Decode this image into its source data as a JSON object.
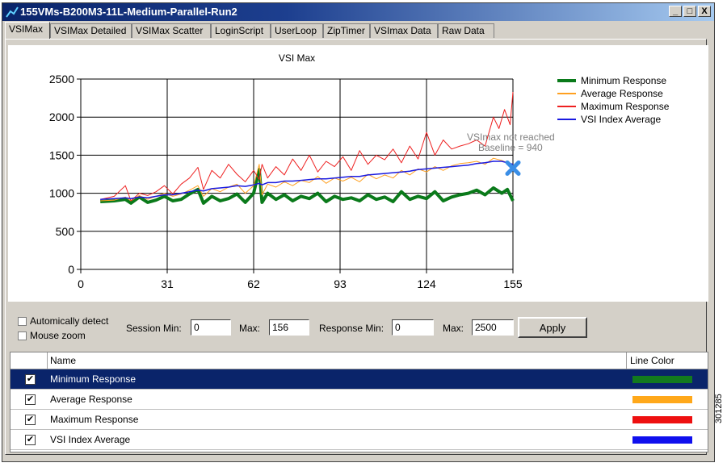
{
  "window": {
    "title": "155VMs-B200M3-11L-Medium-Parallel-Run2",
    "controls": [
      "_",
      "□",
      "X"
    ]
  },
  "tabs": [
    "VSIMax",
    "VSIMax Detailed",
    "VSIMax Scatter",
    "LoginScript",
    "UserLoop",
    "ZipTimer",
    "VSImax Data",
    "Raw Data"
  ],
  "active_tab": "VSIMax",
  "chart_data": {
    "type": "line",
    "title": "VSI Max",
    "xlim": [
      0,
      155
    ],
    "ylim": [
      0,
      2500
    ],
    "x_ticks": [
      "0",
      "31",
      "62",
      "93",
      "124",
      "155"
    ],
    "y_ticks": [
      "0",
      "500",
      "1000",
      "1500",
      "2000",
      "2500"
    ],
    "grid": true,
    "legend_position": "right",
    "annotation": [
      "VSImax not reached",
      "Baseline = 940"
    ],
    "marker": {
      "x": 155,
      "y": 1330,
      "color": "#3a8ee6"
    },
    "series": [
      {
        "name": "Minimum Response",
        "color": "#0a7a1a",
        "x": [
          7,
          12,
          16,
          18,
          21,
          24,
          27,
          30,
          33,
          36,
          39,
          42,
          44,
          47,
          50,
          53,
          56,
          59,
          62,
          64,
          65,
          67,
          70,
          73,
          76,
          79,
          82,
          85,
          88,
          91,
          94,
          97,
          100,
          103,
          106,
          109,
          112,
          115,
          118,
          121,
          124,
          127,
          130,
          133,
          136,
          139,
          142,
          145,
          148,
          151,
          153,
          155
        ],
        "y": [
          890,
          900,
          920,
          870,
          950,
          880,
          910,
          960,
          900,
          920,
          990,
          1050,
          870,
          960,
          900,
          930,
          990,
          880,
          1000,
          1310,
          880,
          1000,
          920,
          980,
          900,
          960,
          930,
          1000,
          890,
          960,
          920,
          940,
          900,
          980,
          920,
          950,
          890,
          1020,
          920,
          960,
          930,
          1020,
          900,
          950,
          980,
          1000,
          1040,
          980,
          1070,
          1000,
          1050,
          900
        ]
      },
      {
        "name": "Average Response",
        "color": "#ffa020",
        "x": [
          7,
          12,
          16,
          18,
          21,
          24,
          27,
          30,
          33,
          36,
          39,
          42,
          44,
          47,
          50,
          53,
          56,
          59,
          62,
          64,
          65,
          67,
          70,
          73,
          76,
          79,
          82,
          85,
          88,
          91,
          94,
          97,
          100,
          103,
          106,
          109,
          112,
          115,
          118,
          121,
          124,
          127,
          130,
          133,
          136,
          139,
          142,
          145,
          148,
          151,
          153,
          155
        ],
        "y": [
          900,
          910,
          950,
          900,
          970,
          920,
          960,
          1000,
          960,
          990,
          1040,
          1100,
          960,
          1060,
          1020,
          1080,
          1120,
          1000,
          1100,
          1380,
          980,
          1120,
          1080,
          1150,
          1100,
          1170,
          1140,
          1220,
          1130,
          1200,
          1160,
          1210,
          1150,
          1250,
          1190,
          1240,
          1200,
          1300,
          1240,
          1320,
          1280,
          1350,
          1300,
          1360,
          1390,
          1400,
          1420,
          1380,
          1460,
          1430,
          1400,
          1360
        ]
      },
      {
        "name": "Maximum Response",
        "color": "#ee2020",
        "x": [
          7,
          12,
          16,
          18,
          21,
          24,
          27,
          30,
          33,
          36,
          39,
          42,
          44,
          47,
          50,
          53,
          56,
          59,
          62,
          64,
          65,
          67,
          70,
          73,
          76,
          79,
          82,
          85,
          88,
          91,
          94,
          97,
          100,
          103,
          106,
          109,
          112,
          115,
          118,
          121,
          124,
          127,
          130,
          133,
          136,
          139,
          142,
          145,
          148,
          150,
          152,
          154,
          155
        ],
        "y": [
          920,
          960,
          1100,
          900,
          1000,
          970,
          1020,
          1100,
          990,
          1120,
          1200,
          1340,
          1050,
          1300,
          1200,
          1380,
          1250,
          1150,
          1300,
          1180,
          1380,
          1200,
          1350,
          1240,
          1450,
          1300,
          1500,
          1280,
          1420,
          1350,
          1480,
          1300,
          1560,
          1380,
          1500,
          1440,
          1580,
          1400,
          1620,
          1450,
          1800,
          1500,
          1700,
          1580,
          1620,
          1650,
          1700,
          1620,
          2000,
          1850,
          2100,
          1900,
          2330
        ]
      },
      {
        "name": "VSI Index Average",
        "color": "#1a1ae0",
        "x": [
          7,
          12,
          16,
          18,
          21,
          24,
          27,
          30,
          33,
          36,
          39,
          42,
          44,
          47,
          50,
          53,
          56,
          59,
          62,
          64,
          65,
          67,
          70,
          73,
          76,
          79,
          82,
          85,
          88,
          91,
          94,
          97,
          100,
          103,
          106,
          109,
          112,
          115,
          118,
          121,
          124,
          127,
          130,
          133,
          136,
          139,
          142,
          145,
          148,
          151,
          153,
          155
        ],
        "y": [
          920,
          930,
          940,
          930,
          950,
          940,
          960,
          980,
          980,
          1000,
          1020,
          1040,
          1030,
          1060,
          1070,
          1080,
          1100,
          1090,
          1110,
          1130,
          1110,
          1140,
          1140,
          1160,
          1160,
          1170,
          1180,
          1190,
          1190,
          1200,
          1210,
          1220,
          1220,
          1240,
          1250,
          1260,
          1270,
          1280,
          1290,
          1310,
          1320,
          1330,
          1340,
          1350,
          1360,
          1370,
          1390,
          1400,
          1420,
          1420,
          1400,
          1380
        ]
      }
    ]
  },
  "options": {
    "auto_detect": "Automically detect",
    "mouse_zoom": "Mouse zoom",
    "session_min_label": "Session Min:",
    "session_min_value": "0",
    "session_max_label": "Max:",
    "session_max_value": "156",
    "response_min_label": "Response Min:",
    "response_min_value": "0",
    "response_max_label": "Max:",
    "response_max_value": "2500",
    "apply": "Apply"
  },
  "series_table": {
    "columns": [
      "Name",
      "Line Color"
    ],
    "rows": [
      {
        "name": "Minimum Response",
        "checked": true,
        "color": "#137a1e"
      },
      {
        "name": "Average Response",
        "checked": true,
        "color": "#ffa81a"
      },
      {
        "name": "Maximum Response",
        "checked": true,
        "color": "#ee1010"
      },
      {
        "name": "VSI Index Average",
        "checked": true,
        "color": "#1010ee"
      }
    ]
  },
  "figure_id": "301285"
}
